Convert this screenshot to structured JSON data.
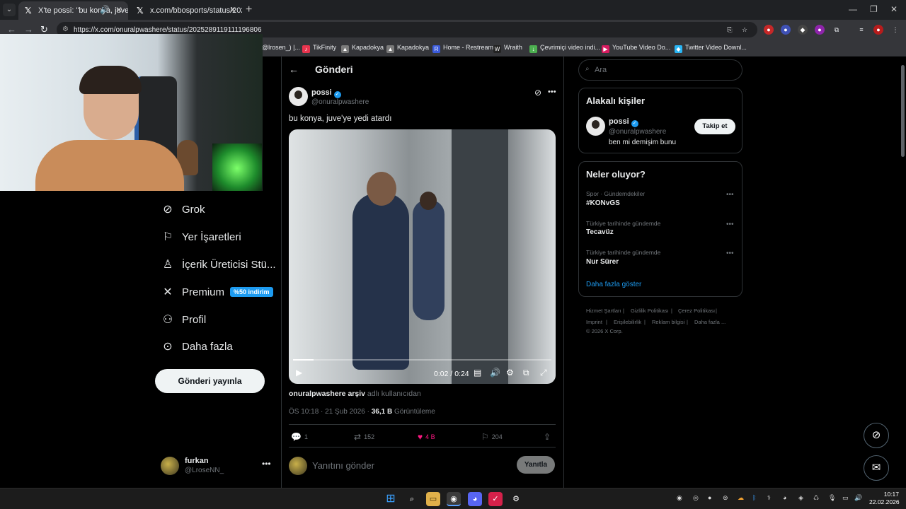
{
  "browser": {
    "tabs": [
      {
        "title": "X'te possi: \"bu konya, juve'y",
        "icon": "x-logo-icon",
        "active": true
      },
      {
        "title": "x.com/bbosports/status/20252",
        "icon": "x-logo-icon",
        "active": false
      }
    ],
    "url": "https://x.com/onuralpwashere/status/2025289119111196806",
    "bookmarks": [
      {
        "label": "@lrosen_) |...",
        "color": "#3d3d3d"
      },
      {
        "label": "TikFinity",
        "color": "#e8344e"
      },
      {
        "label": "Kapadokya",
        "color": "#7a7a7a"
      },
      {
        "label": "Kapadokya",
        "color": "#7a7a7a"
      },
      {
        "label": "Home - Restream",
        "color": "#3b5bdb"
      },
      {
        "label": "Wraith",
        "color": "#222222"
      },
      {
        "label": "Çevrimiçi video indi...",
        "color": "#4caf50"
      },
      {
        "label": "YouTube Video Do...",
        "color": "#d81b60"
      },
      {
        "label": "Twitter Video Downl...",
        "color": "#29b6f6"
      }
    ]
  },
  "nav": {
    "items": [
      {
        "label": "Grok",
        "icon": "grok-icon"
      },
      {
        "label": "Yer İşaretleri",
        "icon": "bookmark-icon"
      },
      {
        "label": "İçerik Üreticisi Stü...",
        "icon": "creator-studio-icon"
      },
      {
        "label": "Premium",
        "icon": "x-logo-icon",
        "badge": "%50 indirim"
      },
      {
        "label": "Profil",
        "icon": "person-icon"
      },
      {
        "label": "Daha fazla",
        "icon": "more-circle-icon"
      }
    ],
    "post_button": "Gönderi yayınla",
    "account": {
      "name": "furkan",
      "handle": "@LroseNN_"
    }
  },
  "main": {
    "title": "Gönderi",
    "post": {
      "author_name": "possi",
      "author_handle": "@onuralpwashere",
      "text": "bu konya, juve'ye yedi atardı",
      "video_time": "0:02 / 0:24",
      "video_progress": 0.08,
      "archive_name": "onuralpwashere arşiv",
      "archive_suffix": "adlı kullanıcıdan",
      "timestamp": "ÖS 10:18 · 21 Şub 2026 ·",
      "views_count": "36,1 B",
      "views_label": "Görüntüleme",
      "replies": "1",
      "reposts": "152",
      "likes": "4 B",
      "bookmarks": "204"
    },
    "reply_placeholder": "Yanıtını gönder",
    "reply_button": "Yanıtla"
  },
  "sidebar": {
    "search_placeholder": "Ara",
    "relevant_title": "Alakalı kişiler",
    "relevant_person": {
      "name": "possi",
      "handle": "@onuralpwashere",
      "bio": "ben mi demişim bunu",
      "follow_label": "Takip et"
    },
    "trends_title": "Neler oluyor?",
    "trends": [
      {
        "category": "Spor · Gündemdekiler",
        "name": "#KONvGS"
      },
      {
        "category": "Türkiye tarihinde gündemde",
        "name": "Tecavüz"
      },
      {
        "category": "Türkiye tarihinde gündemde",
        "name": "Nur Sürer"
      }
    ],
    "show_more": "Daha fazla göster",
    "footer": [
      "Hizmet Şartları",
      "Gizlilik Politikası",
      "Çerez Politikası",
      "Imprint",
      "Erişilebilirlik",
      "Reklam bilgisi",
      "Daha fazla ...",
      "© 2026 X Corp."
    ]
  },
  "taskbar": {
    "time": "10:17",
    "date": "22.02.2026"
  }
}
